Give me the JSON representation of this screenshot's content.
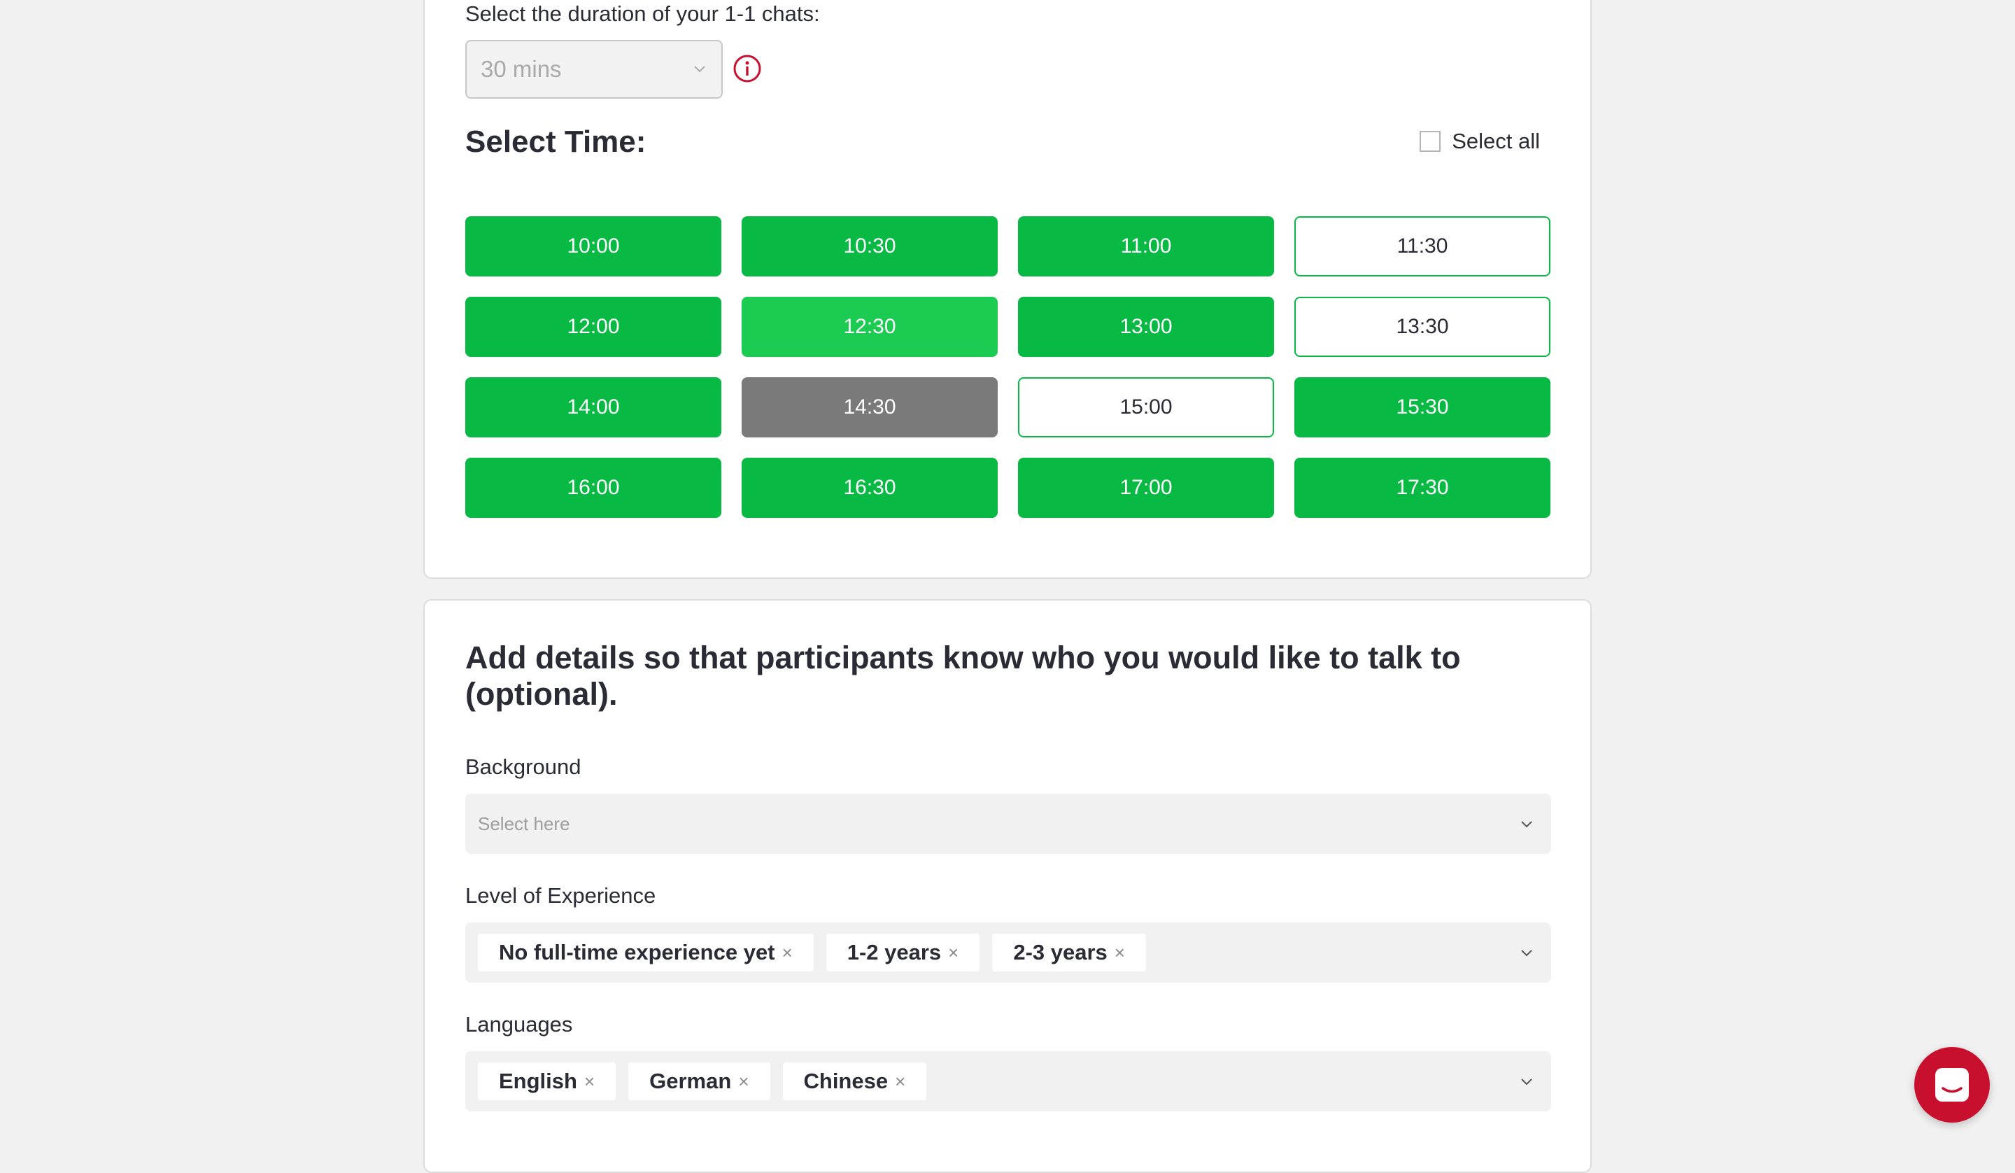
{
  "duration": {
    "label": "Select the duration of your 1-1 chats:",
    "value": "30 mins"
  },
  "time": {
    "title": "Select Time:",
    "select_all_label": "Select all",
    "slots": [
      {
        "label": "10:00",
        "state": "available"
      },
      {
        "label": "10:30",
        "state": "available"
      },
      {
        "label": "11:00",
        "state": "available"
      },
      {
        "label": "11:30",
        "state": "outline"
      },
      {
        "label": "12:00",
        "state": "available"
      },
      {
        "label": "12:30",
        "state": "selected"
      },
      {
        "label": "13:00",
        "state": "available"
      },
      {
        "label": "13:30",
        "state": "outline"
      },
      {
        "label": "14:00",
        "state": "available"
      },
      {
        "label": "14:30",
        "state": "booked"
      },
      {
        "label": "15:00",
        "state": "outline"
      },
      {
        "label": "15:30",
        "state": "available"
      },
      {
        "label": "16:00",
        "state": "available"
      },
      {
        "label": "16:30",
        "state": "available"
      },
      {
        "label": "17:00",
        "state": "available"
      },
      {
        "label": "17:30",
        "state": "available"
      }
    ]
  },
  "details": {
    "title": "Add details so that participants know who you would like to talk to (optional).",
    "background": {
      "label": "Background",
      "placeholder": "Select here"
    },
    "experience": {
      "label": "Level of Experience",
      "chips": [
        "No full-time experience yet",
        "1-2 years",
        "2-3 years"
      ]
    },
    "languages": {
      "label": "Languages",
      "chips": [
        "English",
        "German",
        "Chinese"
      ]
    }
  },
  "colors": {
    "green": "#08b944",
    "green_selected": "#1ccc52",
    "booked_grey": "#7a7a7a",
    "accent_red": "#c8102e"
  },
  "icons": {
    "info": "info-circle-icon",
    "dropdown": "chevron-down-icon",
    "chip_remove": "close-icon",
    "messenger": "chat-bubble-icon"
  }
}
